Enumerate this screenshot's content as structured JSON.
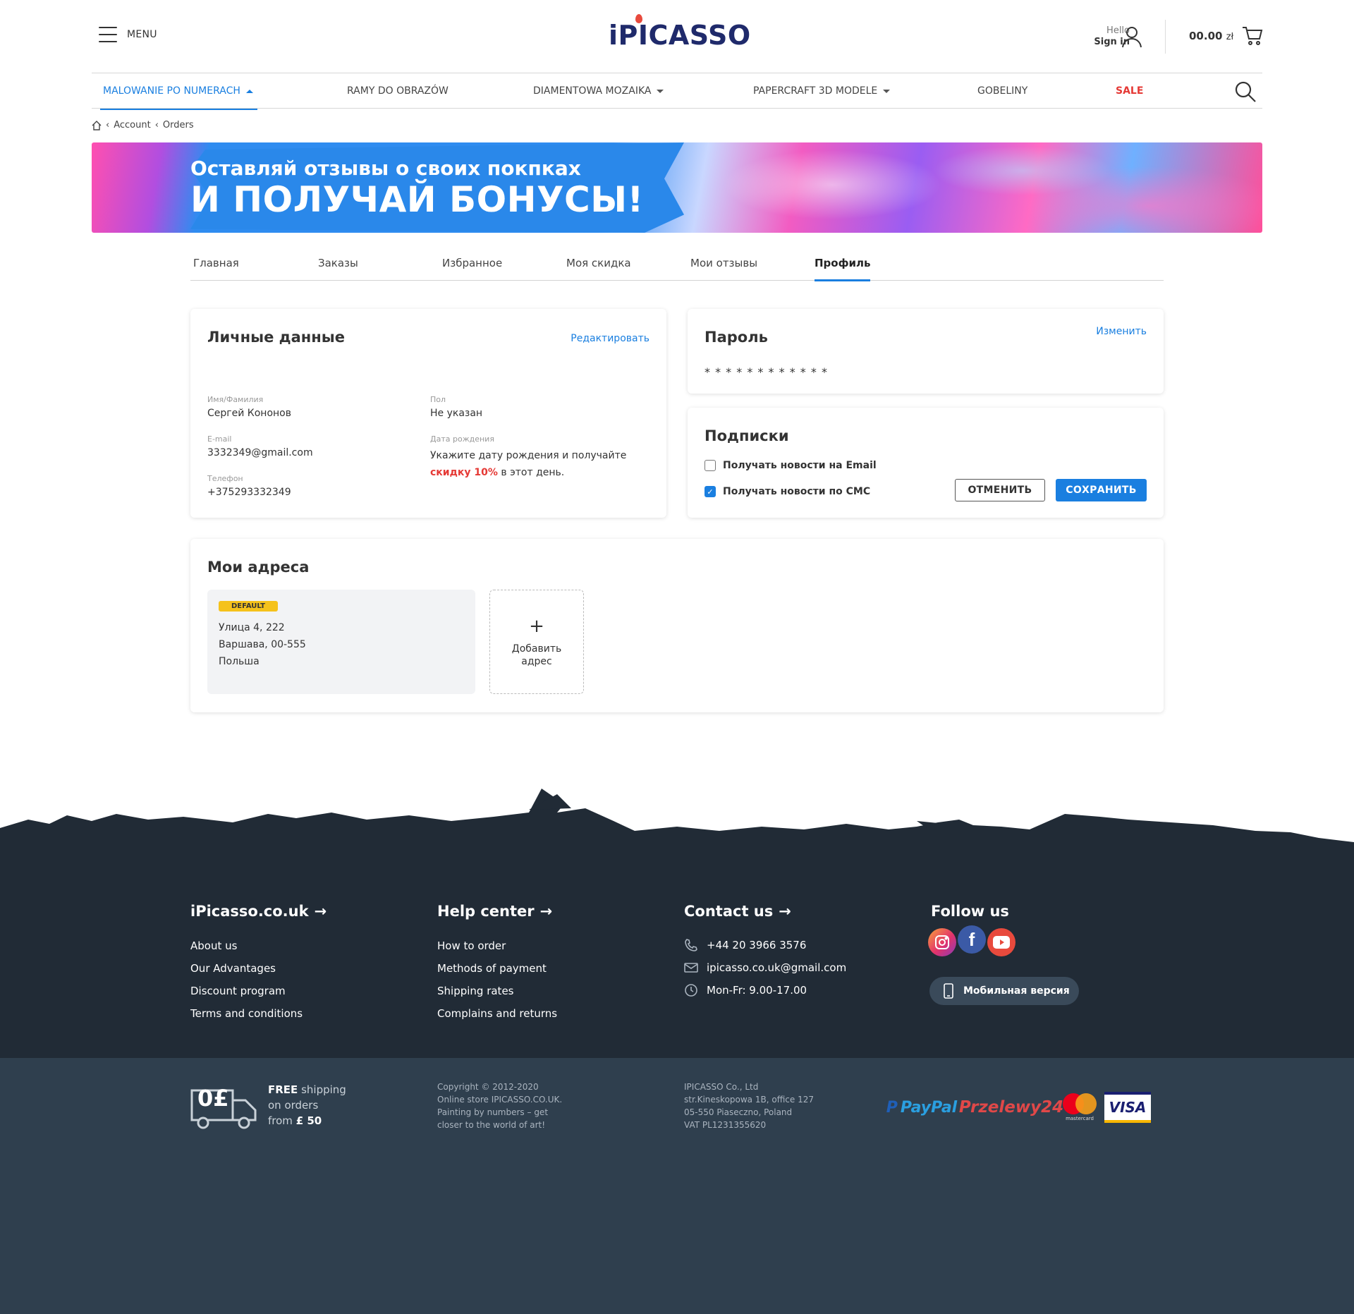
{
  "header": {
    "menu_label": "MENU",
    "logo": "iPICASSO",
    "hello": "Hello",
    "sign_in": "Sign in",
    "cart_amount": "00.00",
    "cart_currency": "zł"
  },
  "nav": [
    {
      "label": "MALOWANIE PO NUMERACH",
      "caret": "up",
      "active": true
    },
    {
      "label": "RAMY DO OBRAZÓW"
    },
    {
      "label": "DIAMENTOWA MOZAIKA",
      "caret": "down"
    },
    {
      "label": "PAPERCRAFT 3D MODELE",
      "caret": "down"
    },
    {
      "label": "GOBELINY"
    },
    {
      "label": "SALE",
      "color": "#e53935"
    }
  ],
  "breadcrumb": [
    "Account",
    "Orders"
  ],
  "banner": {
    "line1": "Оставляй отзывы о своих покпках",
    "line2": "И ПОЛУЧАЙ БОНУСЫ!"
  },
  "tabs": [
    "Главная",
    "Заказы",
    "Избранное",
    "Моя скидка",
    "Мои отзывы",
    "Профиль"
  ],
  "active_tab": "Профиль",
  "personal": {
    "title": "Личные данные",
    "edit": "Редактировать",
    "name_label": "Имя/Фамилия",
    "name": "Сергей Кононов",
    "gender_label": "Пол",
    "gender": "Не указан",
    "email_label": "E-mail",
    "email": "3332349@gmail.com",
    "birth_label": "Дата рождения",
    "birth_text1": "Укажите дату рождения и получайте",
    "birth_highlight": "скидку 10%",
    "birth_text2": "в этот день.",
    "phone_label": "Телефон",
    "phone": "+375293332349"
  },
  "password": {
    "title": "Пароль",
    "change": "Изменить",
    "mask": "* * * * * * * * * * * *"
  },
  "subscriptions": {
    "title": "Подписки",
    "email_opt": "Получать новости на Email",
    "email_checked": false,
    "sms_opt": "Получать новости по СМС",
    "sms_checked": true,
    "cancel": "ОТМЕНИТЬ",
    "save": "СОХРАНИТЬ"
  },
  "addresses": {
    "title": "Мои адреса",
    "badge": "DEFAULT",
    "line1": "Улица 4, 222",
    "line2": "Варшава, 00-555",
    "line3": "Польша",
    "add_label": "Добавить адрес"
  },
  "footer": {
    "col1_title": "iPicasso.co.uk",
    "col1_links": [
      "About us",
      "Our Advantages",
      "Discount program",
      "Terms and conditions"
    ],
    "col2_title": "Help center",
    "col2_links": [
      "How to order",
      "Methods of payment",
      "Shipping rates",
      "Complains and returns"
    ],
    "col3_title": "Contact us",
    "phone": "+44 20 3966 3576",
    "email": "ipicasso.co.uk@gmail.com",
    "hours": "Mon-Fr: 9.00-17.00",
    "col4_title": "Follow us",
    "mobile": "Мобильная версия",
    "free_amount": "0£",
    "free_bold": "FREE",
    "free_rest1": "shipping",
    "free_rest2": "on orders",
    "free_from": "from",
    "free_price": "£ 50",
    "copyright": [
      "Copyright © 2012-2020",
      "Online store IPICASSO.CO.UK.",
      "Painting by numbers – get",
      "closer to the world of art!"
    ],
    "company": [
      "IPICASSO Co., Ltd",
      "str.Kineskopowa 1B, office 127",
      "05-550 Piaseczno, Poland",
      "VAT PL1231355620"
    ],
    "payments": [
      "PayPal",
      "Przelewy24",
      "mastercard",
      "VISA"
    ]
  },
  "colors": {
    "accent": "#1a7fe0",
    "sale": "#e53935",
    "footer_dark": "#212b36",
    "footer_bottom": "#2f3f4e",
    "badge": "#f5c21b"
  }
}
